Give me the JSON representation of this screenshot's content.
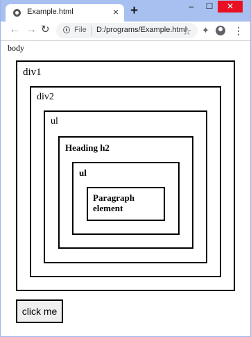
{
  "tab": {
    "title": "Example.html",
    "close": "×",
    "new_tab": "+"
  },
  "window_controls": {
    "minimize": "–",
    "maximize": "☐",
    "close": "✕"
  },
  "toolbar": {
    "back": "←",
    "forward": "→",
    "reload": "↻",
    "omnibox_label": "File",
    "url": "D:/programs/Example.html",
    "star": "☆",
    "extensions": "✦",
    "menu": "⋮"
  },
  "page": {
    "body_label": "body",
    "div1_label": "div1",
    "div2_label": "div2",
    "ul_outer_label": "ul",
    "heading_label": "Heading h2",
    "ul_inner_label": "ul",
    "paragraph_label": "Paragraph element",
    "button_label": "click me"
  }
}
